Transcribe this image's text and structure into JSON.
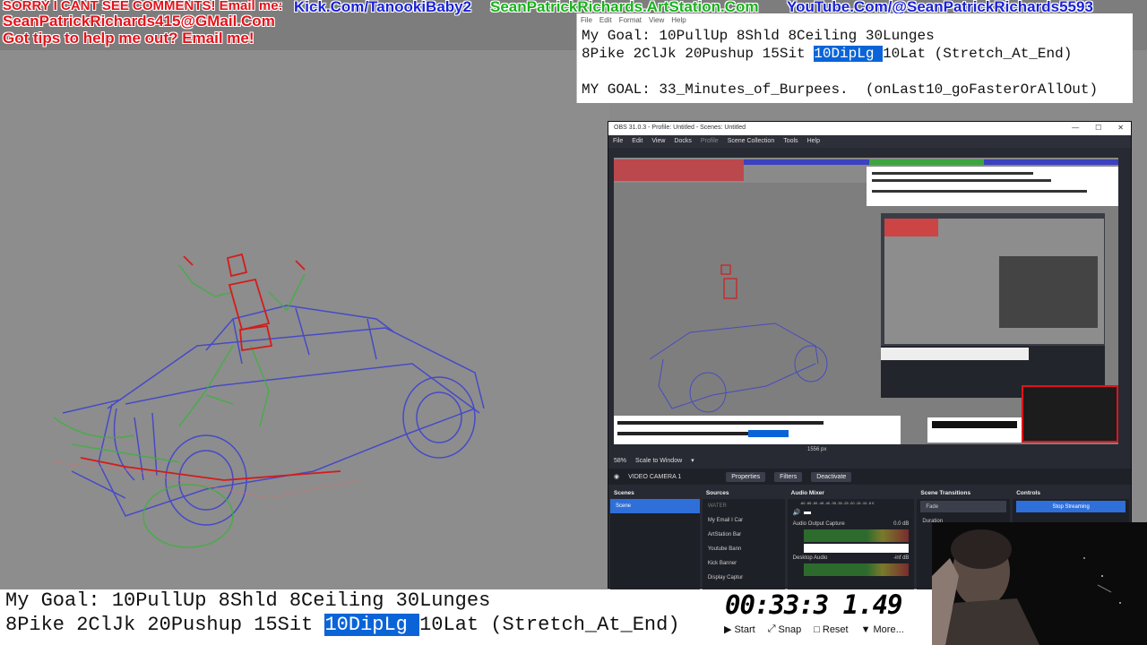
{
  "overlay": {
    "sorry_text": "SORRY I CANT SEE COMMENTS! Email me:",
    "email_text": "SeanPatrickRichards415@GMail.Com",
    "tips_text": "Got tips to help me out? Email me!",
    "kick_link": "Kick.Com/TanookiBaby2",
    "artstation_link": "SeanPatrickRichards.ArtStation.Com",
    "youtube_link": "YouTube.Com/@SeanPatrickRichards5593"
  },
  "notepad": {
    "menu": [
      "File",
      "Edit",
      "Format",
      "View",
      "Help"
    ],
    "line1": "My Goal: 10PullUp 8Shld 8Ceiling 30Lunges",
    "line2_before": "8Pike 2ClJk 20Pushup 15Sit ",
    "line2_highlight": "10DipLg ",
    "line2_after": "10Lat (Stretch_At_End)",
    "line3": "MY GOAL: 33_Minutes_of_Burpees.  (onLast10_goFasterOrAllOut)"
  },
  "obs": {
    "title": "OBS 31.0.3 - Profile: Untitled - Scenes: Untitled",
    "menu": [
      "File",
      "Edit",
      "View",
      "Docks",
      "Profile",
      "Scene Collection",
      "Tools",
      "Help"
    ],
    "preview_size_label": "1556 px",
    "zoom_label": "58%",
    "scale_label": "Scale to Window",
    "source_name": "VIDEO CAMERA 1",
    "buttons": {
      "properties": "Properties",
      "filters": "Filters",
      "deactivate": "Deactivate"
    },
    "docks": {
      "scenes": {
        "title": "Scenes",
        "items": [
          "Scene"
        ]
      },
      "sources": {
        "title": "Sources",
        "items": [
          "WATER",
          "My Email I Car",
          "ArtStation Bar",
          "Youtube Bann",
          "Kick Banner",
          "Display Captur"
        ]
      },
      "audio_mixer": {
        "title": "Audio Mixer",
        "scale": "-60 -55 -50 -45 -40 -35 -30 -25 -20 -15 -10 -5 0",
        "channels": [
          {
            "name": "Audio Output Capture",
            "level": "0.0 dB"
          },
          {
            "name": "Desktop Audio",
            "level": "-inf dB"
          }
        ]
      },
      "transitions": {
        "title": "Scene Transitions",
        "selected": "Fade",
        "duration_label": "Duration"
      },
      "controls": {
        "title": "Controls",
        "stop_streaming": "Stop Streaming"
      }
    }
  },
  "bottom_goal": {
    "line1": "My Goal: 10PullUp 8Shld 8Ceiling 30Lunges",
    "line2_before": "8Pike 2ClJk 20Pushup 15Sit ",
    "line2_highlight": "10DipLg ",
    "line2_after": "10Lat (Stretch_At_End)"
  },
  "timer": {
    "value": "00:33:3 1.49",
    "start": "Start",
    "snap": "Snap",
    "reset": "Reset",
    "more": "More..."
  },
  "colors": {
    "overlay_red": "#e3121a",
    "link_blue": "#1a22d6",
    "link_green": "#19b21d",
    "highlight": "#0a64d8",
    "obs_bg": "#272a33"
  }
}
